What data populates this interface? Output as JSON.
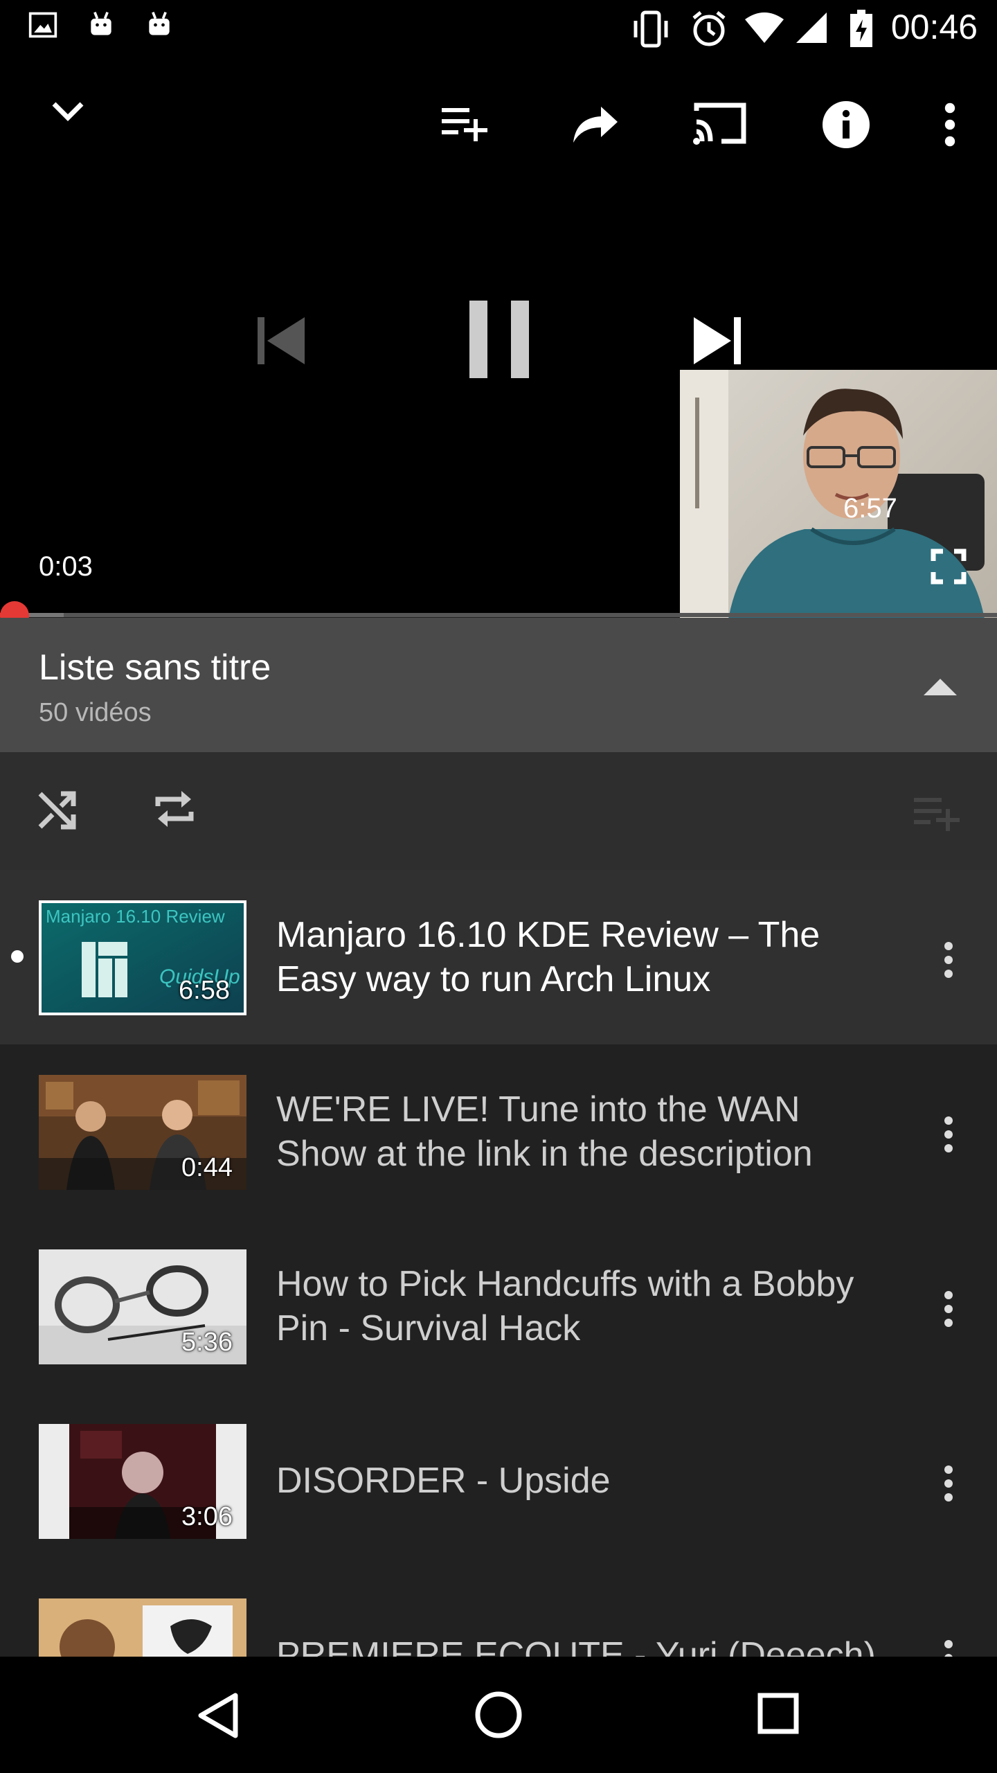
{
  "status_bar": {
    "time": "00:46",
    "icons": [
      "image-icon",
      "android-icon",
      "android-icon",
      "vibrate-icon",
      "alarm-icon",
      "wifi-icon",
      "signal-icon",
      "battery-charging-icon"
    ]
  },
  "player": {
    "toolbar_icons": [
      "collapse-icon",
      "add-to-playlist-icon",
      "share-icon",
      "cast-icon",
      "info-icon",
      "more-vert-icon"
    ],
    "current_time": "0:03",
    "duration": "6:57",
    "progress_fraction": 0.0072
  },
  "playlist": {
    "title": "Liste sans titre",
    "count": "50 vidéos"
  },
  "videos": [
    {
      "title": "Manjaro 16.10 KDE Review – The Easy way to run Arch Linux",
      "duration": "6:58",
      "thumb_text_1": "Manjaro 16.10 Review",
      "thumb_text_2": "QuidsUp",
      "current": true
    },
    {
      "title": "WE'RE LIVE! Tune into the WAN Show at the link in the description",
      "duration": "0:44",
      "current": false
    },
    {
      "title": "How to Pick Handcuffs with a Bobby Pin - Survival Hack",
      "duration": "5:36",
      "current": false
    },
    {
      "title": "DISORDER - Upside",
      "duration": "3:06",
      "current": false
    },
    {
      "title": "PREMIERE ECOUTE - Yuri (Deeech)",
      "duration": "",
      "current": false
    }
  ],
  "colors": {
    "accent": "#e53935",
    "background": "#212121",
    "header": "#4a4a4a"
  }
}
